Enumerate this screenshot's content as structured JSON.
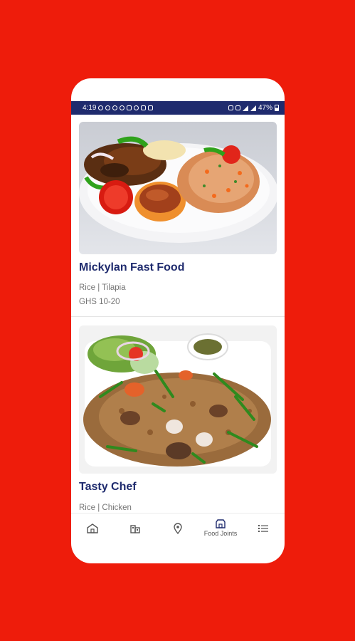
{
  "status_bar": {
    "time": "4:19",
    "battery": "47%"
  },
  "restaurants": [
    {
      "name": "Mickylan Fast Food",
      "category": "Rice | Tilapia",
      "price": "GHS 10-20"
    },
    {
      "name": "Tasty Chef",
      "category": "Rice | Chicken"
    }
  ],
  "bottom_nav": {
    "items": [
      {
        "icon": "home-icon"
      },
      {
        "icon": "buildings-icon"
      },
      {
        "icon": "location-pin-icon"
      },
      {
        "icon": "storefront-icon",
        "label": "Food Joints",
        "active": true
      },
      {
        "icon": "list-menu-icon"
      }
    ]
  },
  "colors": {
    "background": "#ee1c0b",
    "brand": "#1f2b6e",
    "text_secondary": "#757575"
  }
}
